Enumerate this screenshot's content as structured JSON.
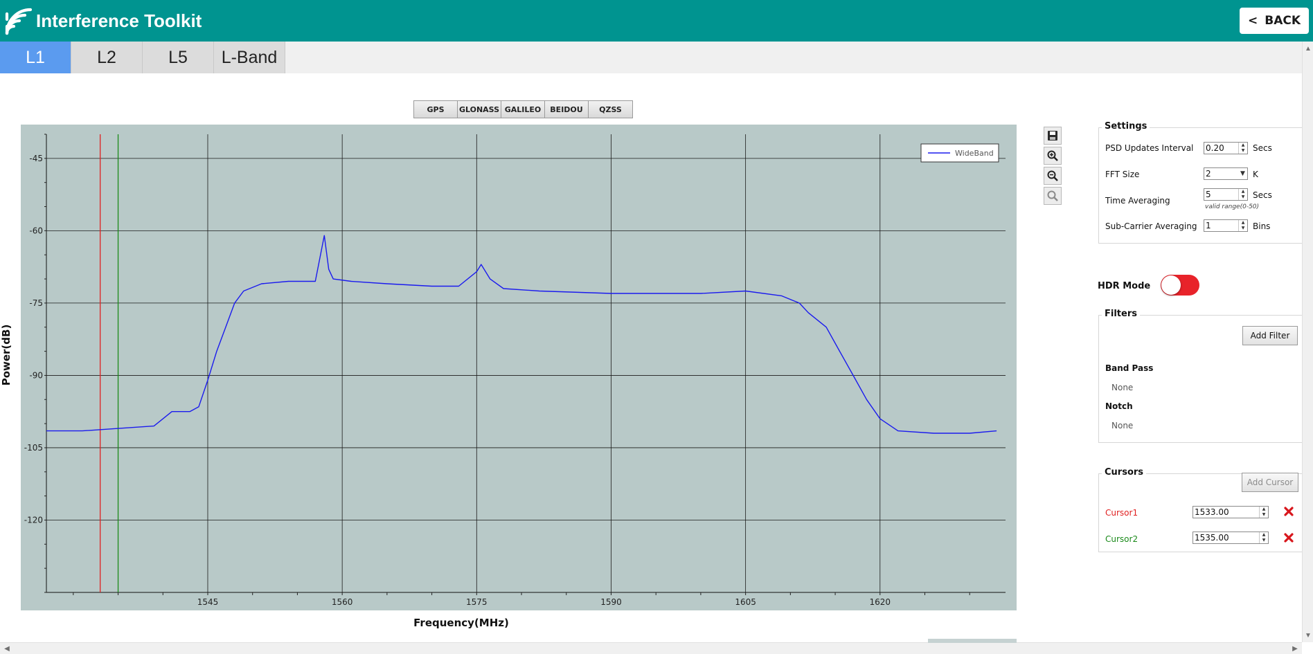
{
  "app": {
    "title": "Interference Toolkit",
    "back_label": "BACK",
    "back_glyph": "<"
  },
  "tabs": [
    {
      "label": "L1",
      "active": true
    },
    {
      "label": "L2",
      "active": false
    },
    {
      "label": "L5",
      "active": false
    },
    {
      "label": "L-Band",
      "active": false
    }
  ],
  "constellations": [
    "GPS",
    "GLONASS",
    "GALILEO",
    "BEIDOU",
    "QZSS"
  ],
  "chart_data": {
    "type": "line",
    "xlabel": "Frequency(MHz)",
    "ylabel": "Power(dB)",
    "xlim": [
      1527,
      1634
    ],
    "ylim": [
      -135,
      -40
    ],
    "xticks": [
      1545,
      1560,
      1575,
      1590,
      1605,
      1620
    ],
    "yticks": [
      -45,
      -60,
      -75,
      -90,
      -105,
      -120
    ],
    "grid": true,
    "legend_position": "top-right",
    "background": "#b8c9c8",
    "series": [
      {
        "name": "WideBand",
        "color": "#1a1aee",
        "x": [
          1527.0,
          1531.0,
          1535.0,
          1539.0,
          1541.0,
          1543.0,
          1544.0,
          1545.0,
          1546.0,
          1547.0,
          1548.0,
          1549.0,
          1551.0,
          1554.0,
          1557.0,
          1558.0,
          1558.5,
          1559.0,
          1561.0,
          1565.0,
          1570.0,
          1573.0,
          1575.0,
          1575.5,
          1576.5,
          1578.0,
          1582.0,
          1590.0,
          1600.0,
          1605.0,
          1609.0,
          1611.0,
          1612.0,
          1614.0,
          1615.5,
          1617.0,
          1618.5,
          1620.0,
          1622.0,
          1626.0,
          1630.0,
          1633.0
        ],
        "values": [
          -101.5,
          -101.5,
          -101.0,
          -100.5,
          -97.5,
          -97.5,
          -96.5,
          -91.0,
          -85.0,
          -80.0,
          -75.0,
          -72.5,
          -71.0,
          -70.5,
          -70.5,
          -61.0,
          -68.0,
          -70.0,
          -70.5,
          -71.0,
          -71.5,
          -71.5,
          -68.5,
          -67.0,
          -70.0,
          -72.0,
          -72.5,
          -73.0,
          -73.0,
          -72.5,
          -73.5,
          -75.0,
          -77.0,
          -80.0,
          -85.0,
          -90.0,
          -95.0,
          -99.0,
          -101.5,
          -102.0,
          -102.0,
          -101.5
        ]
      }
    ]
  },
  "chart_tools": [
    {
      "name": "save-icon"
    },
    {
      "name": "zoom-in-icon"
    },
    {
      "name": "zoom-out-icon"
    },
    {
      "name": "zoom-reset-icon"
    }
  ],
  "settings": {
    "title": "Settings",
    "psd_label": "PSD Updates Interval",
    "psd_value": "0.20",
    "psd_unit": "Secs",
    "fft_label": "FFT Size",
    "fft_value": "2",
    "fft_unit": "K",
    "time_label": "Time Averaging",
    "time_value": "5",
    "time_unit": "Secs",
    "time_hint": "valid range(0-50)",
    "sub_label": "Sub-Carrier Averaging",
    "sub_value": "1",
    "sub_unit": "Bins"
  },
  "hdr": {
    "label": "HDR Mode",
    "on": true,
    "on_color": "#e8232a"
  },
  "filters": {
    "title": "Filters",
    "add_label": "Add Filter",
    "band_pass_label": "Band Pass",
    "band_pass_value": "None",
    "notch_label": "Notch",
    "notch_value": "None"
  },
  "cursors": {
    "title": "Cursors",
    "add_label": "Add Cursor",
    "items": [
      {
        "label": "Cursor1",
        "value": "1533.00",
        "freq": 1533.0,
        "color": "#e02020"
      },
      {
        "label": "Cursor2",
        "value": "1535.00",
        "freq": 1535.0,
        "color": "#1a8a1a"
      }
    ]
  }
}
